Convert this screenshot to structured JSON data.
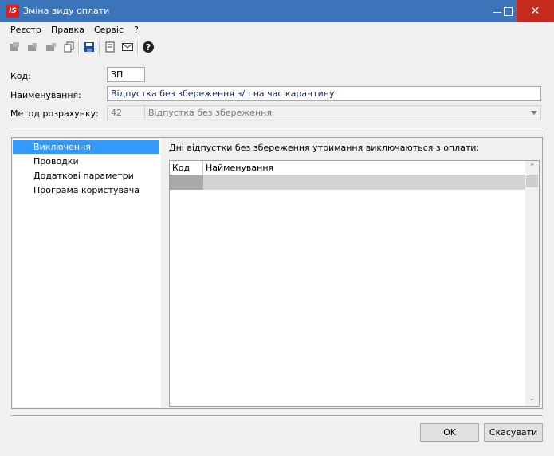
{
  "window": {
    "logo": "IS",
    "title": "Зміна виду оплати"
  },
  "menu": [
    "Реєстр",
    "Правка",
    "Сервіс",
    "?"
  ],
  "toolbar": {
    "icons": [
      "add-row-icon",
      "edit-row-icon",
      "delete-row-icon",
      "copy-icon",
      "save-icon",
      "document-icon",
      "mail-icon",
      "help-icon"
    ]
  },
  "form": {
    "code_label": "Код:",
    "code_value": "ЗП",
    "name_label": "Найменування:",
    "name_value": "Відпустка без збереження з/п на час карантину",
    "method_label": "Метод розрахунку:",
    "method_code": "42",
    "method_value": "Відпустка без збереження"
  },
  "nav": {
    "items": [
      "Виключення",
      "Проводки",
      "Додаткові параметри",
      "Програма користувача"
    ],
    "selected": 0
  },
  "content": {
    "caption": "Дні відпустки без збереження утримання виключаються з оплати:",
    "columns": [
      "Код",
      "Найменування"
    ],
    "rows": [
      [
        "",
        ""
      ]
    ]
  },
  "buttons": {
    "ok": "OK",
    "cancel": "Скасувати"
  },
  "colors": {
    "titlebar": "#3b74b8",
    "selection": "#3399ff",
    "close": "#c42b1c"
  }
}
